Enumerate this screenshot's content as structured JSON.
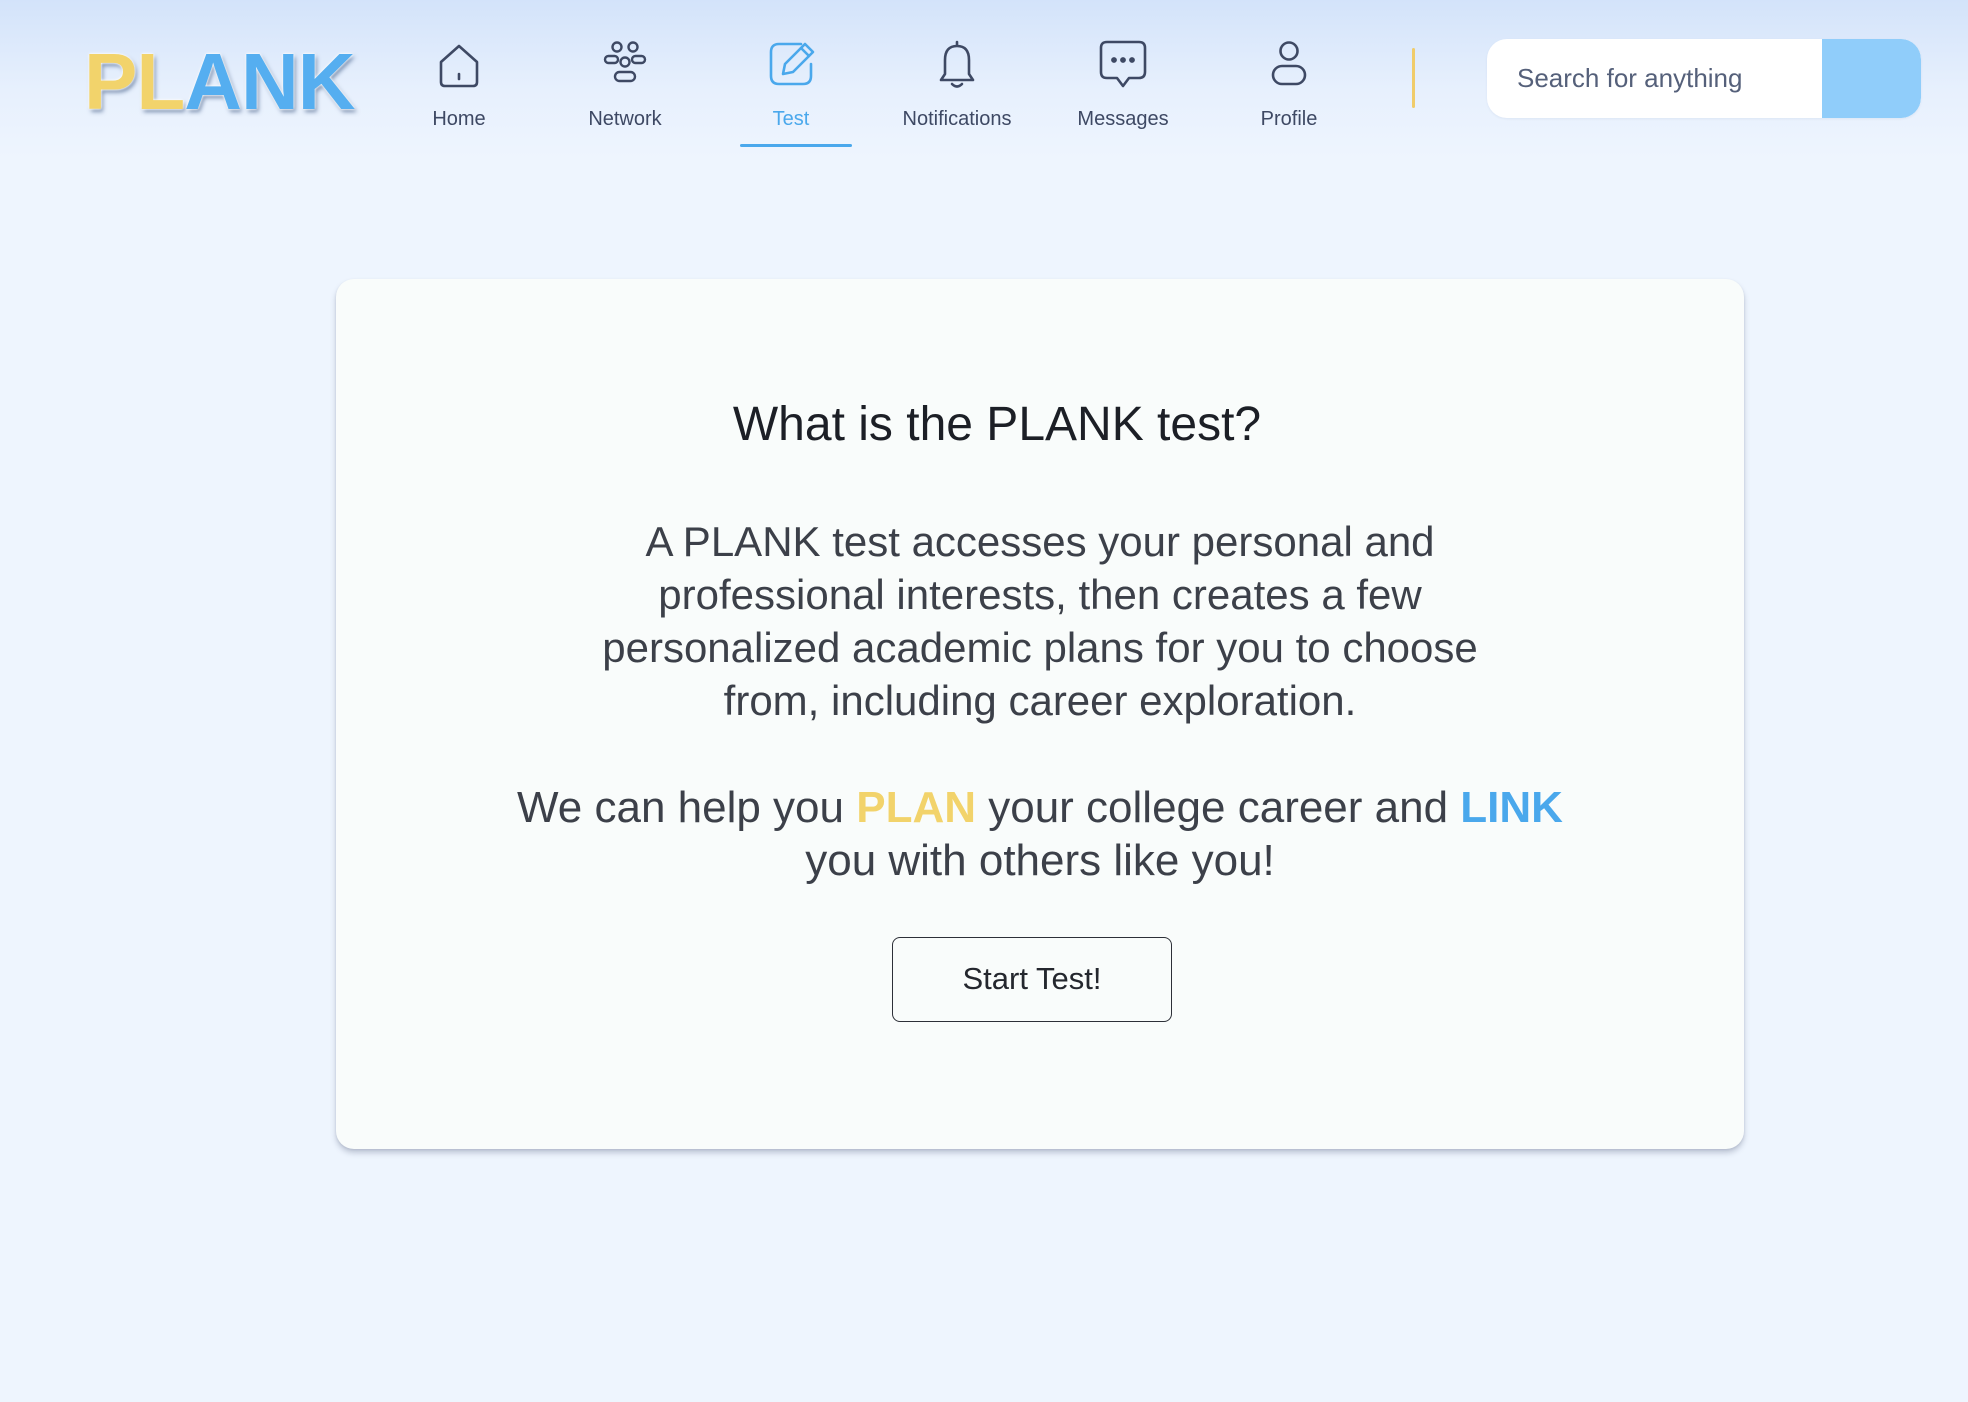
{
  "header": {
    "logo": {
      "part_yellow": "PL",
      "part_blue": "ANK"
    },
    "nav": [
      {
        "key": "home",
        "label": "Home",
        "icon": "home-icon",
        "active": false
      },
      {
        "key": "network",
        "label": "Network",
        "icon": "people-group-icon",
        "active": false
      },
      {
        "key": "test",
        "label": "Test",
        "icon": "edit-pencil-icon",
        "active": true
      },
      {
        "key": "notifications",
        "label": "Notifications",
        "icon": "bell-icon",
        "active": false
      },
      {
        "key": "messages",
        "label": "Messages",
        "icon": "chat-bubble-icon",
        "active": false
      },
      {
        "key": "profile",
        "label": "Profile",
        "icon": "user-icon",
        "active": false
      }
    ],
    "search": {
      "placeholder": "Search for anything",
      "value": ""
    }
  },
  "card": {
    "title": "What is the PLANK test?",
    "description_lines": [
      "A PLANK test accesses your personal and",
      "professional interests, then creates a few",
      "personalized academic plans for you to choose",
      "from, including career exploration."
    ],
    "tagline": {
      "part1": "We can help you ",
      "plan_word": "PLAN",
      "part2": " your college career and ",
      "link_word": "LINK",
      "line2": "you with others like you!"
    },
    "start_button": "Start Test!"
  },
  "colors": {
    "accent_blue": "#4aa8ec",
    "accent_yellow": "#f2d36b",
    "search_button": "#90cdfa",
    "background": "#eef5fe",
    "card": "#f9fcfb",
    "icon_stroke": "#3e4964"
  }
}
